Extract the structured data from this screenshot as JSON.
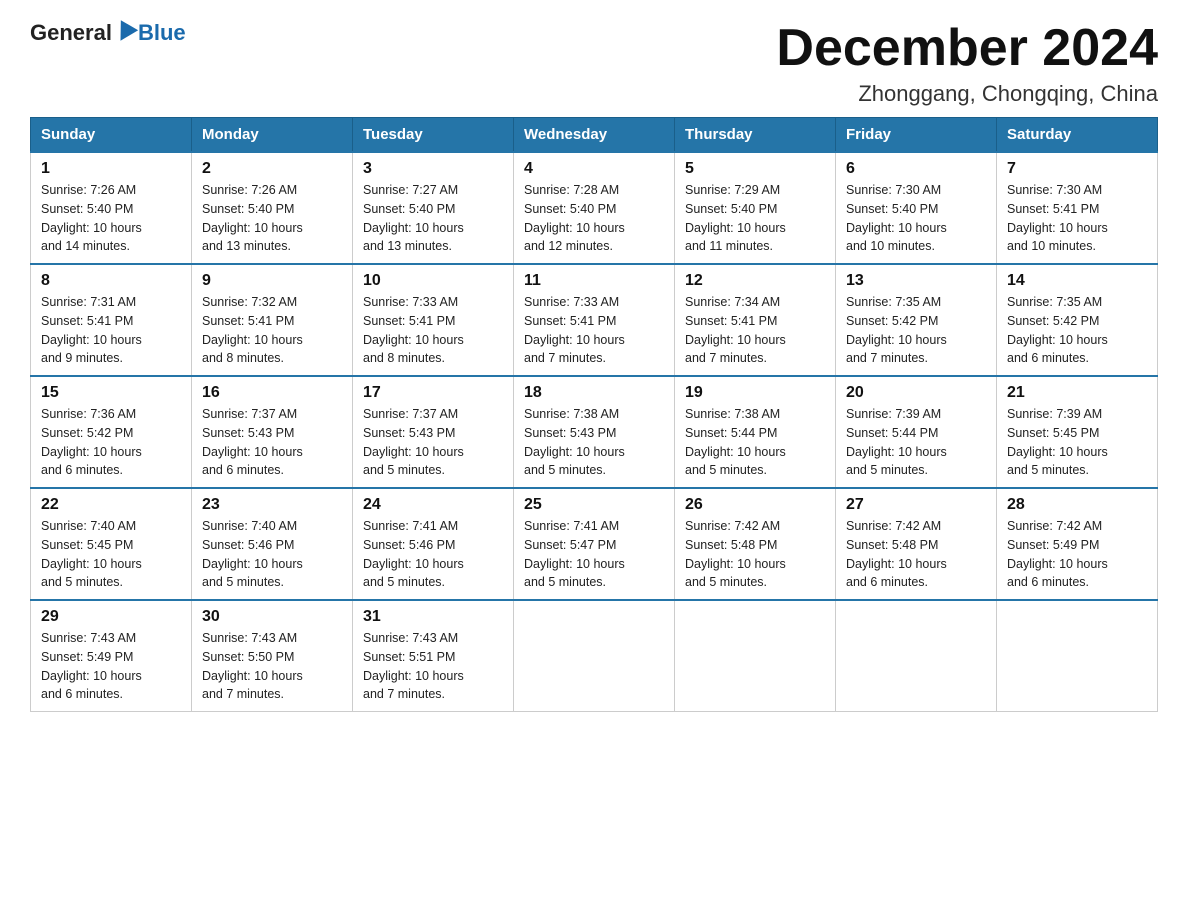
{
  "header": {
    "logo_general": "General",
    "logo_blue": "Blue",
    "month_title": "December 2024",
    "location": "Zhonggang, Chongqing, China"
  },
  "weekdays": [
    "Sunday",
    "Monday",
    "Tuesday",
    "Wednesday",
    "Thursday",
    "Friday",
    "Saturday"
  ],
  "weeks": [
    [
      {
        "day": "1",
        "sunrise": "7:26 AM",
        "sunset": "5:40 PM",
        "daylight": "10 hours and 14 minutes."
      },
      {
        "day": "2",
        "sunrise": "7:26 AM",
        "sunset": "5:40 PM",
        "daylight": "10 hours and 13 minutes."
      },
      {
        "day": "3",
        "sunrise": "7:27 AM",
        "sunset": "5:40 PM",
        "daylight": "10 hours and 13 minutes."
      },
      {
        "day": "4",
        "sunrise": "7:28 AM",
        "sunset": "5:40 PM",
        "daylight": "10 hours and 12 minutes."
      },
      {
        "day": "5",
        "sunrise": "7:29 AM",
        "sunset": "5:40 PM",
        "daylight": "10 hours and 11 minutes."
      },
      {
        "day": "6",
        "sunrise": "7:30 AM",
        "sunset": "5:40 PM",
        "daylight": "10 hours and 10 minutes."
      },
      {
        "day": "7",
        "sunrise": "7:30 AM",
        "sunset": "5:41 PM",
        "daylight": "10 hours and 10 minutes."
      }
    ],
    [
      {
        "day": "8",
        "sunrise": "7:31 AM",
        "sunset": "5:41 PM",
        "daylight": "10 hours and 9 minutes."
      },
      {
        "day": "9",
        "sunrise": "7:32 AM",
        "sunset": "5:41 PM",
        "daylight": "10 hours and 8 minutes."
      },
      {
        "day": "10",
        "sunrise": "7:33 AM",
        "sunset": "5:41 PM",
        "daylight": "10 hours and 8 minutes."
      },
      {
        "day": "11",
        "sunrise": "7:33 AM",
        "sunset": "5:41 PM",
        "daylight": "10 hours and 7 minutes."
      },
      {
        "day": "12",
        "sunrise": "7:34 AM",
        "sunset": "5:41 PM",
        "daylight": "10 hours and 7 minutes."
      },
      {
        "day": "13",
        "sunrise": "7:35 AM",
        "sunset": "5:42 PM",
        "daylight": "10 hours and 7 minutes."
      },
      {
        "day": "14",
        "sunrise": "7:35 AM",
        "sunset": "5:42 PM",
        "daylight": "10 hours and 6 minutes."
      }
    ],
    [
      {
        "day": "15",
        "sunrise": "7:36 AM",
        "sunset": "5:42 PM",
        "daylight": "10 hours and 6 minutes."
      },
      {
        "day": "16",
        "sunrise": "7:37 AM",
        "sunset": "5:43 PM",
        "daylight": "10 hours and 6 minutes."
      },
      {
        "day": "17",
        "sunrise": "7:37 AM",
        "sunset": "5:43 PM",
        "daylight": "10 hours and 5 minutes."
      },
      {
        "day": "18",
        "sunrise": "7:38 AM",
        "sunset": "5:43 PM",
        "daylight": "10 hours and 5 minutes."
      },
      {
        "day": "19",
        "sunrise": "7:38 AM",
        "sunset": "5:44 PM",
        "daylight": "10 hours and 5 minutes."
      },
      {
        "day": "20",
        "sunrise": "7:39 AM",
        "sunset": "5:44 PM",
        "daylight": "10 hours and 5 minutes."
      },
      {
        "day": "21",
        "sunrise": "7:39 AM",
        "sunset": "5:45 PM",
        "daylight": "10 hours and 5 minutes."
      }
    ],
    [
      {
        "day": "22",
        "sunrise": "7:40 AM",
        "sunset": "5:45 PM",
        "daylight": "10 hours and 5 minutes."
      },
      {
        "day": "23",
        "sunrise": "7:40 AM",
        "sunset": "5:46 PM",
        "daylight": "10 hours and 5 minutes."
      },
      {
        "day": "24",
        "sunrise": "7:41 AM",
        "sunset": "5:46 PM",
        "daylight": "10 hours and 5 minutes."
      },
      {
        "day": "25",
        "sunrise": "7:41 AM",
        "sunset": "5:47 PM",
        "daylight": "10 hours and 5 minutes."
      },
      {
        "day": "26",
        "sunrise": "7:42 AM",
        "sunset": "5:48 PM",
        "daylight": "10 hours and 5 minutes."
      },
      {
        "day": "27",
        "sunrise": "7:42 AM",
        "sunset": "5:48 PM",
        "daylight": "10 hours and 6 minutes."
      },
      {
        "day": "28",
        "sunrise": "7:42 AM",
        "sunset": "5:49 PM",
        "daylight": "10 hours and 6 minutes."
      }
    ],
    [
      {
        "day": "29",
        "sunrise": "7:43 AM",
        "sunset": "5:49 PM",
        "daylight": "10 hours and 6 minutes."
      },
      {
        "day": "30",
        "sunrise": "7:43 AM",
        "sunset": "5:50 PM",
        "daylight": "10 hours and 7 minutes."
      },
      {
        "day": "31",
        "sunrise": "7:43 AM",
        "sunset": "5:51 PM",
        "daylight": "10 hours and 7 minutes."
      },
      null,
      null,
      null,
      null
    ]
  ]
}
